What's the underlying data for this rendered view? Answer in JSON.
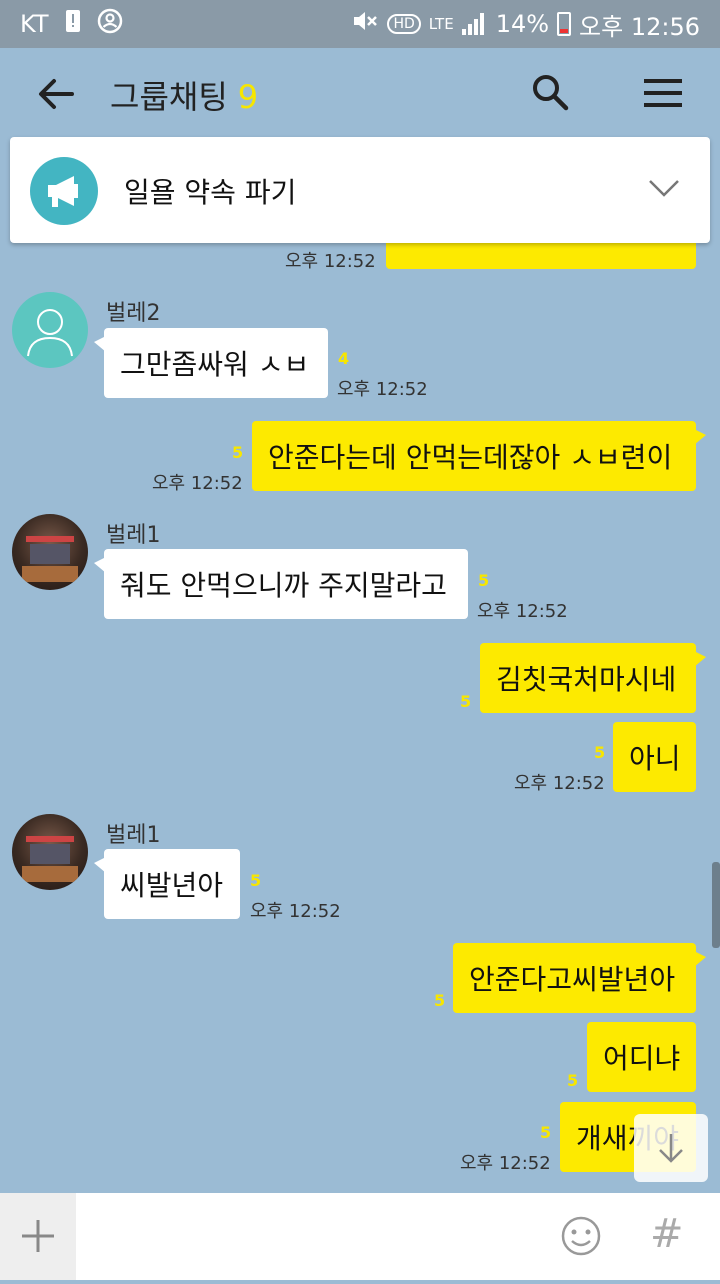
{
  "status_bar": {
    "carrier": "KT",
    "lte": "LTE",
    "hd": "HD",
    "battery": "14%",
    "time": "오후 12:56"
  },
  "header": {
    "title": "그룹채팅",
    "member_count": "9"
  },
  "notice": {
    "text": "일욜 약속 파기"
  },
  "messages": [
    {
      "id": "m0",
      "text": "",
      "time": "오후 12:52"
    },
    {
      "id": "m1",
      "sender": "벌레2",
      "text": "그만좀싸워 ㅅㅂ",
      "unread": "4",
      "time": "오후 12:52"
    },
    {
      "id": "m2",
      "text": "안준다는데 안먹는데잖아 ㅅㅂ련이",
      "unread": "5",
      "time": "오후 12:52"
    },
    {
      "id": "m3",
      "sender": "벌레1",
      "text": "줘도 안먹으니까 주지말라고",
      "unread": "5",
      "time": "오후 12:52"
    },
    {
      "id": "m4",
      "text": "김칫국처마시네",
      "unread": "5"
    },
    {
      "id": "m5",
      "text": "아니",
      "unread": "5",
      "time": "오후 12:52"
    },
    {
      "id": "m6",
      "sender": "벌레1",
      "text": "씨발년아",
      "unread": "5",
      "time": "오후 12:52"
    },
    {
      "id": "m7",
      "text": "안준다고씨발년아",
      "unread": "5"
    },
    {
      "id": "m8",
      "text": "어디냐",
      "unread": "5"
    },
    {
      "id": "m9",
      "text": "개새끼야",
      "unread": "5",
      "time": "오후 12:52"
    }
  ],
  "input": {
    "placeholder": "",
    "hashtag": "#"
  },
  "colors": {
    "background": "#9bbbd4",
    "my_bubble": "#fdea00",
    "their_bubble": "#ffffff",
    "accent_count": "#f7e600",
    "notice_icon": "#43b5c2"
  }
}
